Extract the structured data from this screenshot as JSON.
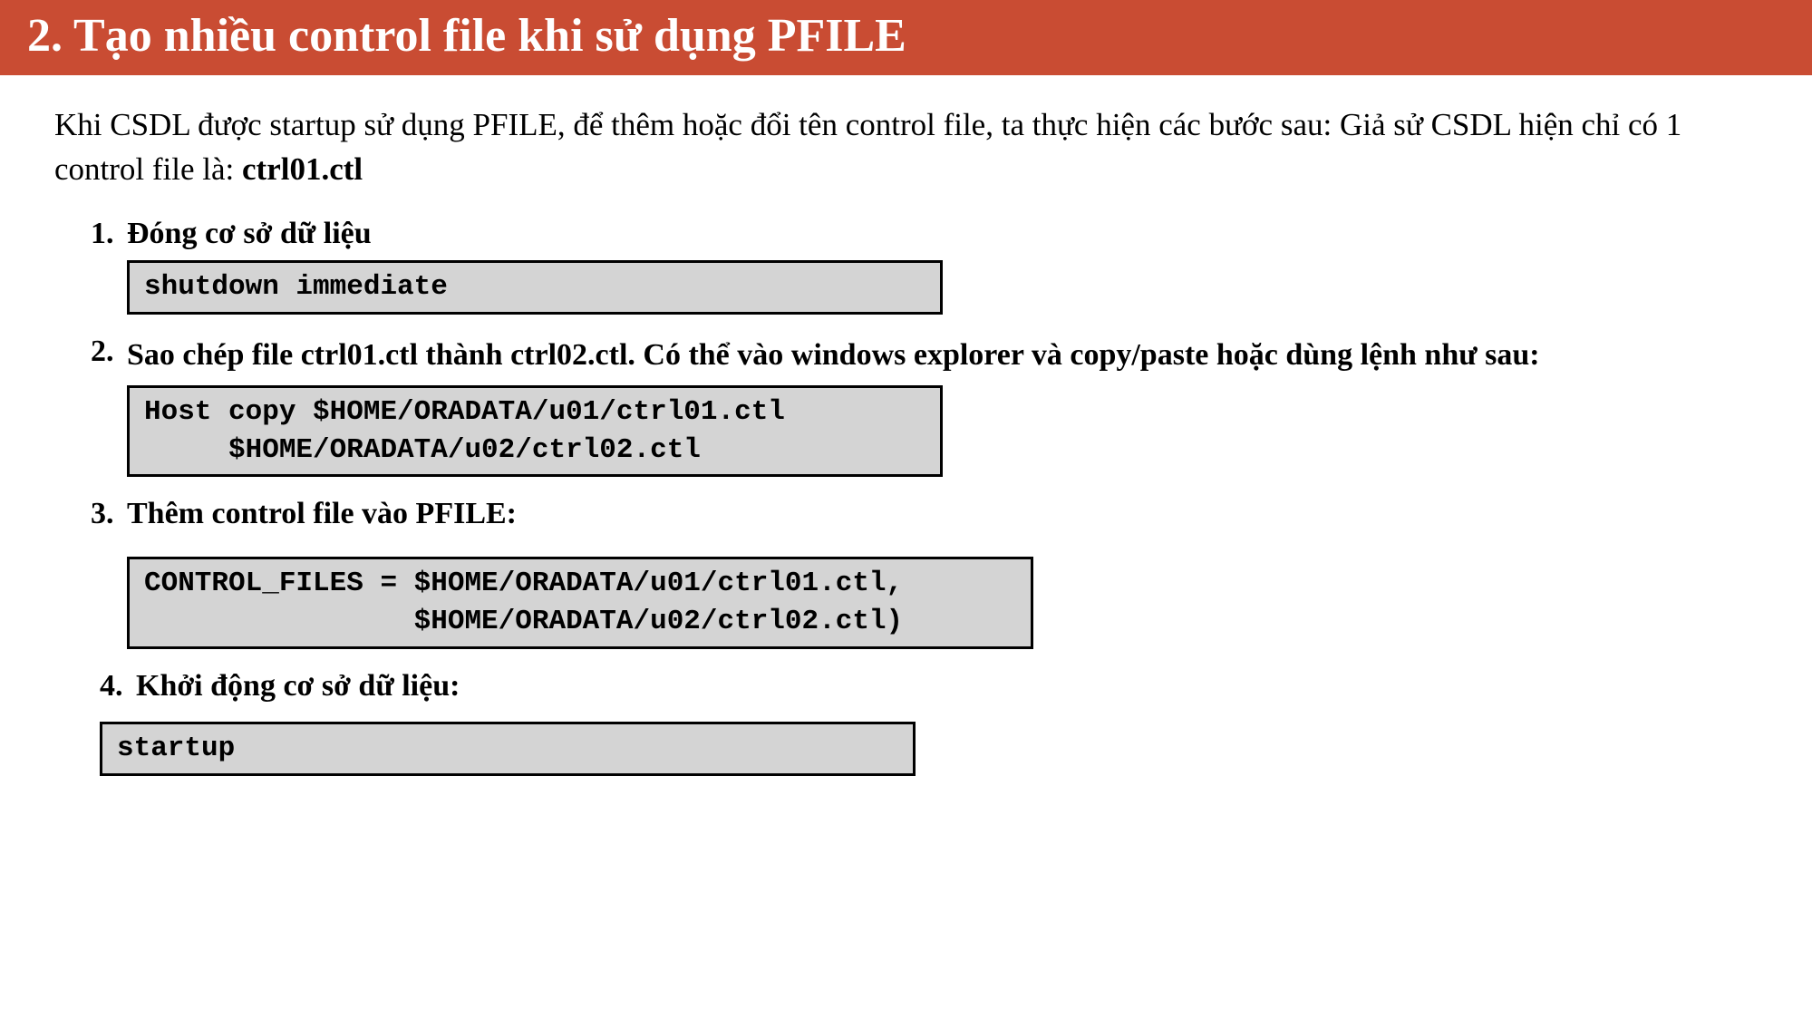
{
  "header": {
    "title": "2. Tạo nhiều control file khi sử dụng PFILE"
  },
  "intro": {
    "text_part1": "Khi CSDL được startup sử dụng PFILE, để thêm hoặc đổi tên control file, ta thực hiện các bước sau: Giả sử CSDL hiện chỉ có 1 control file là: ",
    "text_bold": "ctrl01.ctl"
  },
  "steps": {
    "step1": {
      "number": "1.",
      "title": "Đóng cơ sở dữ liệu",
      "code": "shutdown immediate"
    },
    "step2": {
      "number": "2.",
      "title": "Sao chép file ctrl01.ctl thành ctrl02.ctl. Có thể vào windows explorer và copy/paste hoặc dùng lệnh như sau:",
      "code": "Host copy $HOME/ORADATA/u01/ctrl01.ctl\n     $HOME/ORADATA/u02/ctrl02.ctl"
    },
    "step3": {
      "number": "3.",
      "title": "Thêm control file vào PFILE:",
      "code": "CONTROL_FILES = $HOME/ORADATA/u01/ctrl01.ctl,\n                $HOME/ORADATA/u02/ctrl02.ctl)"
    },
    "step4": {
      "number": "4.",
      "title": "Khởi động cơ sở dữ liệu:",
      "code": "startup"
    }
  }
}
